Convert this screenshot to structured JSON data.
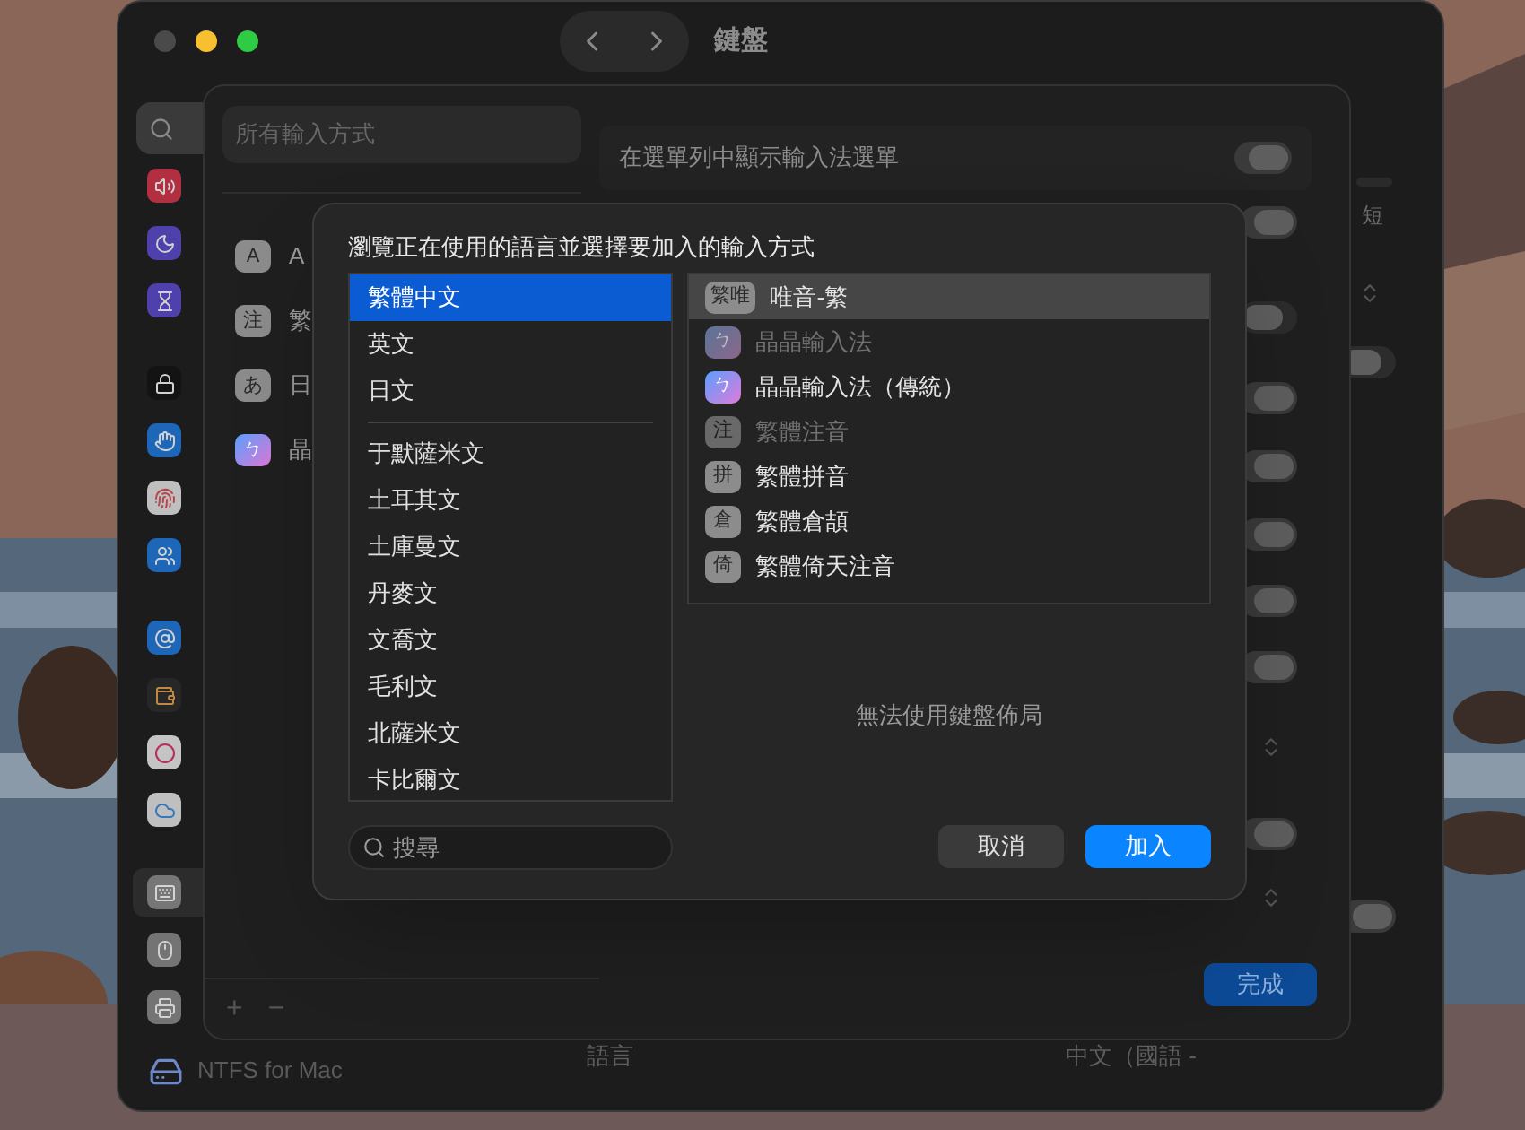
{
  "window": {
    "title": "鍵盤"
  },
  "sidebar": {
    "items": [
      {
        "selected": false
      },
      {
        "selected": false
      },
      {
        "selected": false
      },
      {
        "selected": false
      },
      {
        "selected": false
      },
      {
        "selected": false
      },
      {
        "selected": false
      },
      {
        "selected": false
      },
      {
        "selected": false
      },
      {
        "selected": false
      },
      {
        "selected": false
      },
      {
        "selected": true
      },
      {
        "selected": false
      },
      {
        "selected": false
      }
    ],
    "footer": "NTFS for Mac"
  },
  "background": {
    "short_label": "短",
    "language_label": "語言",
    "language_value": "中文（國語 -",
    "toggles": [
      {
        "on": false
      },
      {
        "on": true
      }
    ]
  },
  "sheet": {
    "search": {
      "placeholder": "所有輸入方式"
    },
    "sources": [
      {
        "badge": "A",
        "kind": "plain",
        "label": "A"
      },
      {
        "badge": "注",
        "kind": "plain",
        "label": "繁"
      },
      {
        "badge": "あ",
        "kind": "plain",
        "label": "日"
      },
      {
        "badge": "ㄅ",
        "kind": "gradient",
        "label": "晶"
      }
    ],
    "add_button": "+",
    "remove_button": "−",
    "settings_row": {
      "label": "在選單列中顯示輸入法選單",
      "on": true
    },
    "toggles": [
      {
        "on": true
      },
      {
        "on": false
      },
      {
        "on": true
      },
      {
        "on": true
      },
      {
        "on": true
      },
      {
        "on": true
      },
      {
        "on": true
      },
      {
        "on": true
      }
    ],
    "done_button": "完成"
  },
  "dialog": {
    "title": "瀏覽正在使用的語言並選擇要加入的輸入方式",
    "language_groups": [
      {
        "items": [
          {
            "label": "繁體中文",
            "selected": true
          },
          {
            "label": "英文",
            "selected": false
          },
          {
            "label": "日文",
            "selected": false
          }
        ]
      },
      {
        "items": [
          {
            "label": "于默薩米文",
            "selected": false
          },
          {
            "label": "土耳其文",
            "selected": false
          },
          {
            "label": "土庫曼文",
            "selected": false
          },
          {
            "label": "丹麥文",
            "selected": false
          },
          {
            "label": "文喬文",
            "selected": false
          },
          {
            "label": "毛利文",
            "selected": false
          },
          {
            "label": "北薩米文",
            "selected": false
          },
          {
            "label": "卡比爾文",
            "selected": false
          }
        ]
      }
    ],
    "methods": [
      {
        "badge": "繁唯",
        "kind": "plain",
        "label": "唯音-繁",
        "selected": true,
        "disabled": false
      },
      {
        "badge": "ㄅ",
        "kind": "gradient",
        "label": "晶晶輸入法",
        "selected": false,
        "disabled": true
      },
      {
        "badge": "ㄅ",
        "kind": "gradient",
        "label": "晶晶輸入法（傳統）",
        "selected": false,
        "disabled": false
      },
      {
        "badge": "注",
        "kind": "plain",
        "label": "繁體注音",
        "selected": false,
        "disabled": true
      },
      {
        "badge": "拼",
        "kind": "plain",
        "label": "繁體拼音",
        "selected": false,
        "disabled": false
      },
      {
        "badge": "倉",
        "kind": "plain",
        "label": "繁體倉頡",
        "selected": false,
        "disabled": false
      },
      {
        "badge": "倚",
        "kind": "plain",
        "label": "繁體倚天注音",
        "selected": false,
        "disabled": false
      }
    ],
    "search": {
      "placeholder": "搜尋"
    },
    "message": "無法使用鍵盤佈局",
    "buttons": [
      {
        "label": "取消",
        "kind": "secondary"
      },
      {
        "label": "加入",
        "kind": "primary"
      }
    ]
  }
}
